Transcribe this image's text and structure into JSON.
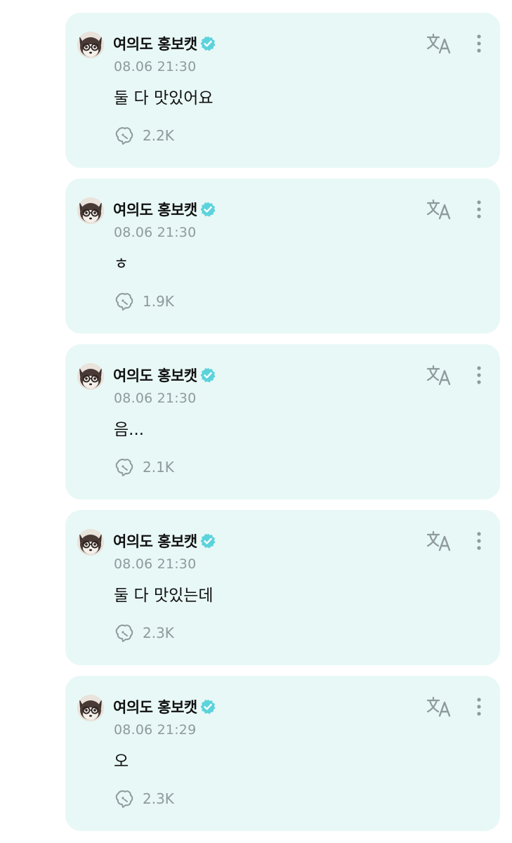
{
  "colors": {
    "card_bg": "#e8f8f6",
    "verified": "#5cd3dc",
    "muted": "#8e9a9c",
    "text": "#111111"
  },
  "icons": {
    "translate": "translate-icon",
    "more": "more-vertical-icon",
    "views": "view-count-icon",
    "verified": "verified-badge-icon"
  },
  "posts": [
    {
      "author": "여의도 홍보캣",
      "time": "08.06 21:30",
      "text": "둘 다 맛있어요",
      "views": "2.2K"
    },
    {
      "author": "여의도 홍보캣",
      "time": "08.06 21:30",
      "text": "ㅎ",
      "views": "1.9K"
    },
    {
      "author": "여의도 홍보캣",
      "time": "08.06 21:30",
      "text": "음...",
      "views": "2.1K"
    },
    {
      "author": "여의도 홍보캣",
      "time": "08.06 21:30",
      "text": "둘 다 맛있는데",
      "views": "2.3K"
    },
    {
      "author": "여의도 홍보캣",
      "time": "08.06 21:29",
      "text": "오",
      "views": "2.3K"
    }
  ]
}
